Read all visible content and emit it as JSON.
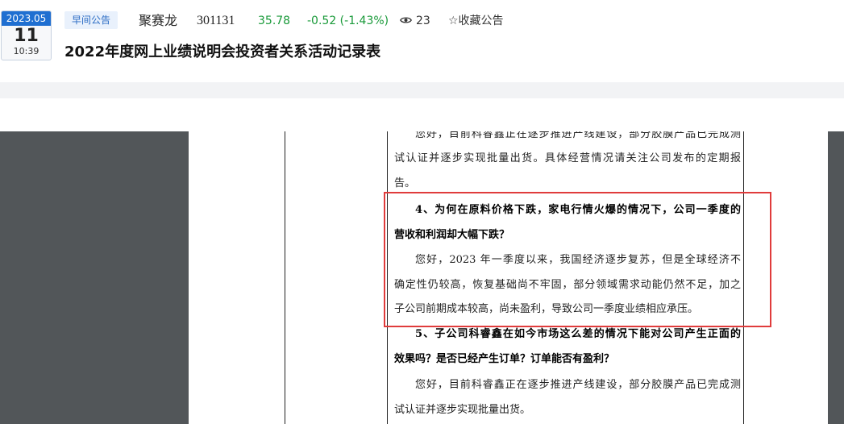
{
  "date": {
    "year_month": "2023.05",
    "day": "11",
    "time": "10:39"
  },
  "tag": "早间公告",
  "stock": {
    "name": "聚赛龙",
    "code": "301131",
    "price": "35.78",
    "change": "-0.52 (-1.43%)",
    "views": "23",
    "favorite": "☆收藏公告"
  },
  "title": "2022年度网上业绩说明会投资者关系活动记录表",
  "colors": {
    "accent": "#1f6fd1",
    "down": "#1a9a3a",
    "highlight": "#e03c3c"
  },
  "icons": {
    "views": "eye-icon",
    "favorite": "star-icon"
  },
  "document": {
    "lines": [
      "您好，目前科睿鑫正在逐步推进产线建设，部分胶膜产品已完成测",
      "试认证并逐步实现批量出货。具体经营情况请关注公司发布的定期报",
      "告。",
      "4、为何在原料价格下跌，家电行情火爆的情况下，公司一季度的",
      "营收和利润却大幅下跌？",
      "您好，2023 年一季度以来，我国经济逐步复苏，但是全球经济不",
      "确定性仍较高，恢复基础尚不牢固，部分领域需求动能仍然不足，加之",
      "子公司前期成本较高，尚未盈利，导致公司一季度业绩相应承压。",
      "5、子公司科睿鑫在如今市场这么差的情况下能对公司产生正面的",
      "效果吗？是否已经产生订单？订单能否有盈利？",
      "您好，目前科睿鑫正在逐步推进产线建设，部分胶膜产品已完成测",
      "试认证并逐步实现批量出货。"
    ]
  }
}
